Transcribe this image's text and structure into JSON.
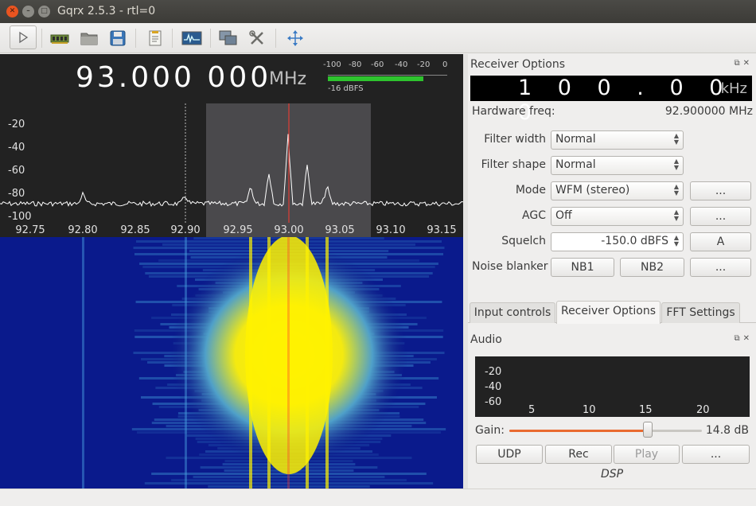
{
  "window": {
    "title": "Gqrx 2.5.3 - rtl=0"
  },
  "toolbar": {
    "icons": [
      "play-icon",
      "hardware-icon",
      "open-folder-icon",
      "save-icon",
      "notes-icon",
      "signal-icon",
      "network-icon",
      "tools-icon",
      "move-icon"
    ]
  },
  "frequency": {
    "value": "93.000 000",
    "unit": "MHz"
  },
  "meter": {
    "scale": [
      "-100",
      "-80",
      "-60",
      "-40",
      "-20",
      "0"
    ],
    "reading": "-16 dBFS",
    "level_fraction": 0.8,
    "color": "#2ec32e"
  },
  "spectrum": {
    "y_ticks": [
      "-20",
      "-40",
      "-60",
      "-80",
      "-100"
    ],
    "x_ticks": [
      "92.75",
      "92.80",
      "92.85",
      "92.90",
      "92.95",
      "93.00",
      "93.05",
      "93.10",
      "93.15"
    ],
    "center_line_color": "#ff3b2f",
    "filter_color": "#4a494c"
  },
  "receiver": {
    "dock_title": "Receiver Options",
    "offset_value": "1 0 0 . 0 0 0",
    "offset_unit": "kHz",
    "hw_freq_label": "Hardware freq:",
    "hw_freq_value": "92.900000 MHz",
    "filter_width_label": "Filter width",
    "filter_width_value": "Normal",
    "filter_shape_label": "Filter shape",
    "filter_shape_value": "Normal",
    "mode_label": "Mode",
    "mode_value": "WFM (stereo)",
    "mode_more": "...",
    "agc_label": "AGC",
    "agc_value": "Off",
    "agc_more": "...",
    "squelch_label": "Squelch",
    "squelch_value": "-150.0 dBFS",
    "squelch_auto": "A",
    "nb_label": "Noise blanker",
    "nb1": "NB1",
    "nb2": "NB2",
    "nb_more": "..."
  },
  "tabs": [
    "Input controls",
    "Receiver Options",
    "FFT Settings"
  ],
  "audio": {
    "dock_title": "Audio",
    "y_ticks": [
      "-20",
      "-40",
      "-60"
    ],
    "x_ticks": [
      "5",
      "10",
      "15",
      "20"
    ],
    "gain_label": "Gain:",
    "gain_value": "14.8 dB",
    "gain_fraction": 0.72,
    "udp": "UDP",
    "rec": "Rec",
    "play": "Play",
    "more": "...",
    "dsp": "DSP"
  }
}
